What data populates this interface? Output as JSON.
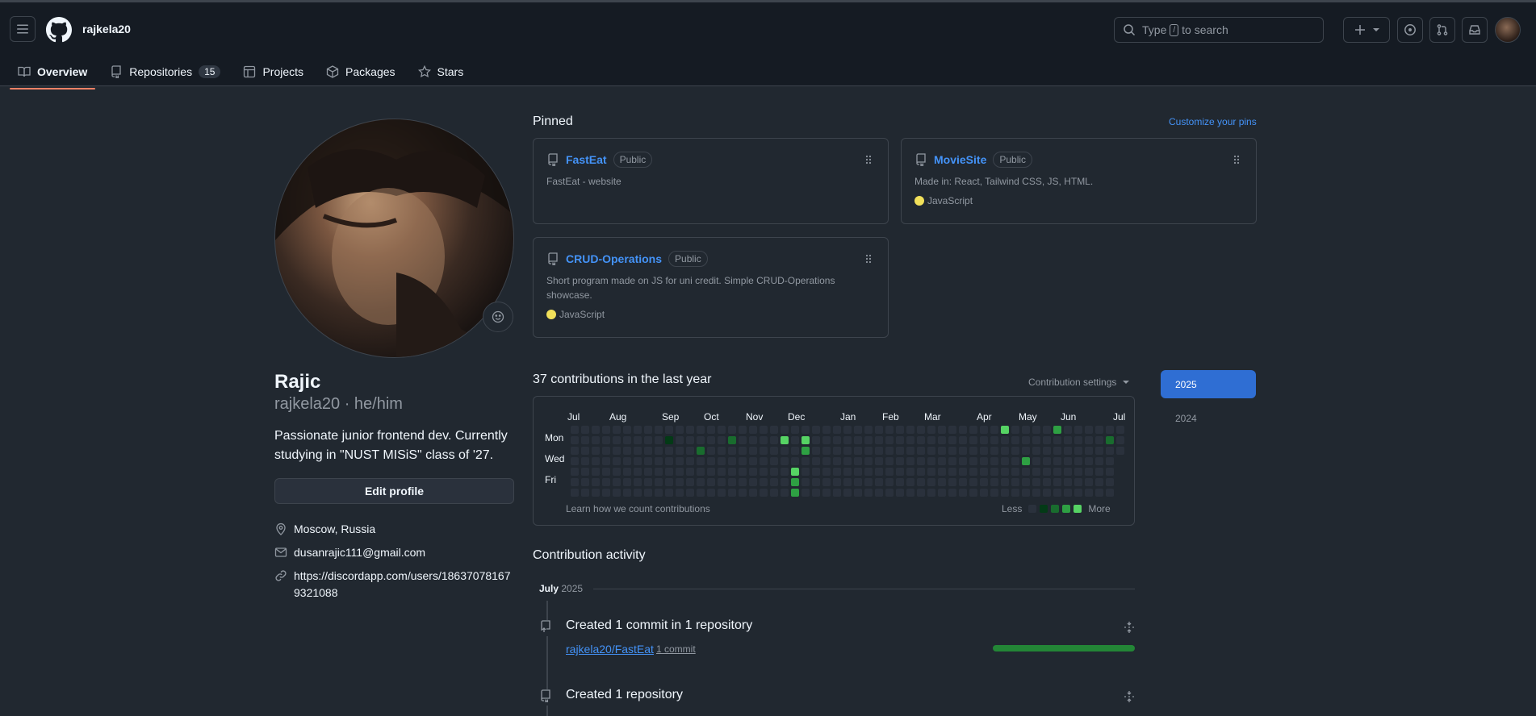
{
  "header": {
    "username": "rajkela20",
    "search_placeholder_a": "Type",
    "search_key": "/",
    "search_placeholder_b": "to search"
  },
  "tabs": [
    {
      "label": "Overview",
      "icon": "book-icon",
      "active": true
    },
    {
      "label": "Repositories",
      "icon": "repo-icon",
      "count": "15"
    },
    {
      "label": "Projects",
      "icon": "table-icon"
    },
    {
      "label": "Packages",
      "icon": "package-icon"
    },
    {
      "label": "Stars",
      "icon": "star-icon"
    }
  ],
  "profile": {
    "name": "Rajic",
    "login_pronouns": "rajkela20 · he/him",
    "bio": "Passionate junior frontend dev. Currently studying in \"NUST MISiS\" class of '27.",
    "edit_label": "Edit profile",
    "location": "Moscow, Russia",
    "email": "dusanrajic111@gmail.com",
    "link": "https://discordapp.com/users/186370781679321088"
  },
  "pinned": {
    "title": "Pinned",
    "customize": "Customize your pins",
    "repos": [
      {
        "name": "FastEat",
        "visibility": "Public",
        "description": "FastEat - website",
        "language": ""
      },
      {
        "name": "MovieSite",
        "visibility": "Public",
        "description": "Made in: React, Tailwind CSS, JS, HTML.",
        "language": "JavaScript",
        "lang_color": "#f1e05a"
      },
      {
        "name": "CRUD-Operations",
        "visibility": "Public",
        "description": "Short program made on JS for uni credit. Simple CRUD-Operations showcase.",
        "language": "JavaScript",
        "lang_color": "#f1e05a"
      }
    ]
  },
  "contributions": {
    "title": "37 contributions in the last year",
    "settings": "Contribution settings",
    "months": [
      "Jul",
      "Aug",
      "Sep",
      "Oct",
      "Nov",
      "Dec",
      "Jan",
      "Feb",
      "Mar",
      "Apr",
      "May",
      "Jun",
      "Jul"
    ],
    "days": [
      "Mon",
      "Wed",
      "Fri"
    ],
    "learn": "Learn how we count contributions",
    "less": "Less",
    "more": "More",
    "active_cells": [
      {
        "week": 9,
        "day": 1,
        "level": 1
      },
      {
        "week": 12,
        "day": 2,
        "level": 2
      },
      {
        "week": 15,
        "day": 1,
        "level": 2
      },
      {
        "week": 20,
        "day": 1,
        "level": 4
      },
      {
        "week": 21,
        "day": 4,
        "level": 4
      },
      {
        "week": 21,
        "day": 5,
        "level": 3
      },
      {
        "week": 21,
        "day": 6,
        "level": 3
      },
      {
        "week": 22,
        "day": 1,
        "level": 4
      },
      {
        "week": 22,
        "day": 2,
        "level": 3
      },
      {
        "week": 41,
        "day": 0,
        "level": 4
      },
      {
        "week": 43,
        "day": 3,
        "level": 3
      },
      {
        "week": 46,
        "day": 0,
        "level": 3
      },
      {
        "week": 51,
        "day": 1,
        "level": 2
      }
    ],
    "colors": [
      "#2a313c",
      "#033a16",
      "#196c2e",
      "#2ea043",
      "#56d364"
    ]
  },
  "years": [
    "2025",
    "2024"
  ],
  "activity": {
    "title": "Contribution activity",
    "month": "July",
    "year": "2025",
    "items": [
      {
        "text": "Created 1 commit in 1 repository",
        "repo": "rajkela20/FastEat",
        "count": "1 commit",
        "progress": 1.0
      },
      {
        "text": "Created 1 repository"
      }
    ]
  }
}
